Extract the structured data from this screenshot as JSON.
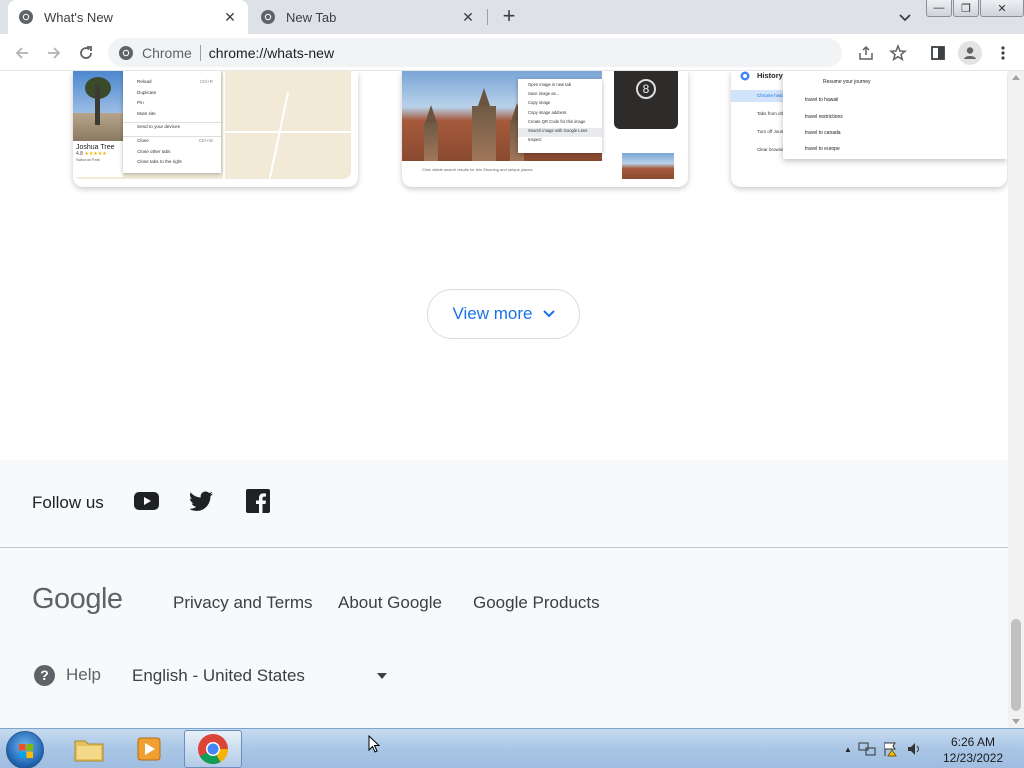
{
  "browser": {
    "tabs": [
      {
        "title": "What's New",
        "active": true
      },
      {
        "title": "New Tab",
        "active": false
      }
    ],
    "new_tab_symbol": "+",
    "close_symbol": "✕",
    "omnibox": {
      "site_name": "Chrome",
      "url": "chrome://whats-new"
    },
    "window_controls": {
      "minimize": "—",
      "restore": "❐",
      "close": "✕"
    },
    "icons": [
      "back-arrow-icon",
      "forward-arrow-icon",
      "reload-icon",
      "share-icon",
      "bookmark-star-icon",
      "side-panel-icon",
      "profile-icon",
      "menu-dots-icon",
      "tab-search-icon"
    ]
  },
  "cards": {
    "card1": {
      "place_name": "Joshua Tree",
      "rating": "4.8",
      "stars": "★★★★★",
      "place_type": "National Park",
      "context_menu": [
        {
          "label": "Reload",
          "shortcut": "Ctrl+R"
        },
        {
          "label": "Duplicate",
          "shortcut": ""
        },
        {
          "label": "Pin",
          "shortcut": ""
        },
        {
          "label": "Mute site",
          "shortcut": ""
        },
        {
          "label": "Send to your devices",
          "shortcut": ""
        },
        {
          "label": "Close",
          "shortcut": "Ctrl+W"
        },
        {
          "label": "Close other tabs",
          "shortcut": ""
        },
        {
          "label": "Close tabs to the right",
          "shortcut": ""
        }
      ]
    },
    "card2": {
      "context_menu": [
        "Open image in new tab",
        "Save image as...",
        "Copy image",
        "Copy image address",
        "Create QR Code for this image",
        "Search image with Google Lens",
        "Inspect"
      ],
      "phone_number": "8",
      "caption": "Click visible search results for this Stunning and unique places"
    },
    "card3": {
      "title": "History",
      "rows": [
        "Chrome history",
        "Tabs from other devices",
        "Turn off Journeys",
        "Clear browsing data"
      ],
      "dropdown_header": "Resume your journey",
      "dropdown_items": [
        "travel to hawaii",
        "travel restrictions",
        "travel to canada",
        "travel to europe"
      ]
    }
  },
  "view_more": {
    "label": "View more"
  },
  "footer": {
    "follow_label": "Follow us",
    "social": [
      "youtube-icon",
      "twitter-icon",
      "facebook-icon"
    ],
    "logo_text": "Google",
    "links": [
      "Privacy and Terms",
      "About Google",
      "Google Products"
    ],
    "help_label": "Help",
    "help_glyph": "?",
    "language": "English - United States"
  },
  "taskbar": {
    "items": [
      "start-button",
      "windows-explorer",
      "media-player",
      "chrome"
    ],
    "clock_time": "6:26 AM",
    "clock_date": "12/23/2022",
    "tray_arrow": "▲"
  }
}
